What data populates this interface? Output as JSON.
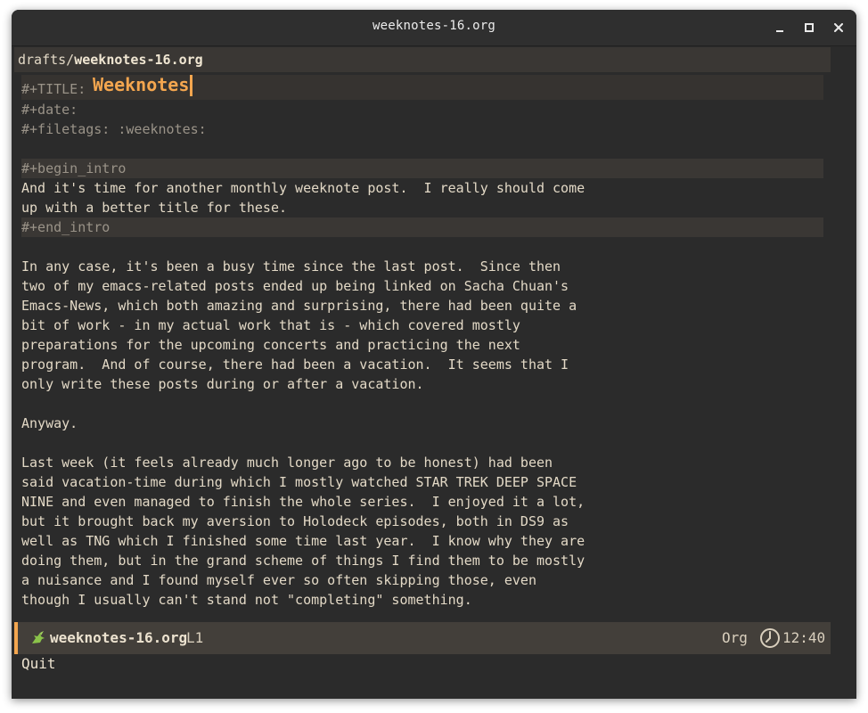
{
  "window": {
    "title": "weeknotes-16.org"
  },
  "header": {
    "dir": "drafts/",
    "file": "weeknotes-16.org"
  },
  "buffer": {
    "title_keyword": "#+TITLE: ",
    "title_value": "Weeknotes",
    "lines": [
      {
        "text": "#+date:",
        "kind": "meta"
      },
      {
        "text": "#+filetags: :weeknotes:",
        "kind": "meta"
      },
      {
        "text": "",
        "kind": "text"
      },
      {
        "text": "#+begin_intro",
        "kind": "delim"
      },
      {
        "text": "And it's time for another monthly weeknote post.  I really should come",
        "kind": "text"
      },
      {
        "text": "up with a better title for these.",
        "kind": "text"
      },
      {
        "text": "#+end_intro",
        "kind": "delim"
      },
      {
        "text": "",
        "kind": "text"
      },
      {
        "text": "In any case, it's been a busy time since the last post.  Since then",
        "kind": "text"
      },
      {
        "text": "two of my emacs-related posts ended up being linked on Sacha Chuan's",
        "kind": "text"
      },
      {
        "text": "Emacs-News, which both amazing and surprising, there had been quite a",
        "kind": "text"
      },
      {
        "text": "bit of work - in my actual work that is - which covered mostly",
        "kind": "text"
      },
      {
        "text": "preparations for the upcoming concerts and practicing the next",
        "kind": "text"
      },
      {
        "text": "program.  And of course, there had been a vacation.  It seems that I",
        "kind": "text"
      },
      {
        "text": "only write these posts during or after a vacation.",
        "kind": "text"
      },
      {
        "text": "",
        "kind": "text"
      },
      {
        "text": "Anyway.",
        "kind": "text"
      },
      {
        "text": "",
        "kind": "text"
      },
      {
        "text": "Last week (it feels already much longer ago to be honest) had been",
        "kind": "text"
      },
      {
        "text": "said vacation-time during which I mostly watched STAR TREK DEEP SPACE",
        "kind": "text"
      },
      {
        "text": "NINE and even managed to finish the whole series.  I enjoyed it a lot,",
        "kind": "text"
      },
      {
        "text": "but it brought back my aversion to Holodeck episodes, both in DS9 as",
        "kind": "text"
      },
      {
        "text": "well as TNG which I finished some time last year.  I know why they are",
        "kind": "text"
      },
      {
        "text": "doing them, but in the grand scheme of things I find them to be mostly",
        "kind": "text"
      },
      {
        "text": "a nuisance and I found myself ever so often skipping those, even",
        "kind": "text"
      },
      {
        "text": "though I usually can't stand not \"completing\" something.",
        "kind": "text"
      }
    ]
  },
  "modeline": {
    "icon": "unicorn-icon",
    "buffer_name": "weeknotes-16.org",
    "line": "L1",
    "major_mode": "Org",
    "time": "12:40",
    "accent_color": "#f4a64f"
  },
  "echo_area": {
    "message": "Quit"
  },
  "colors": {
    "background": "#2b2b2b",
    "foreground": "#e3d9c6",
    "title": "#f4a64f",
    "meta": "#9a9388"
  }
}
